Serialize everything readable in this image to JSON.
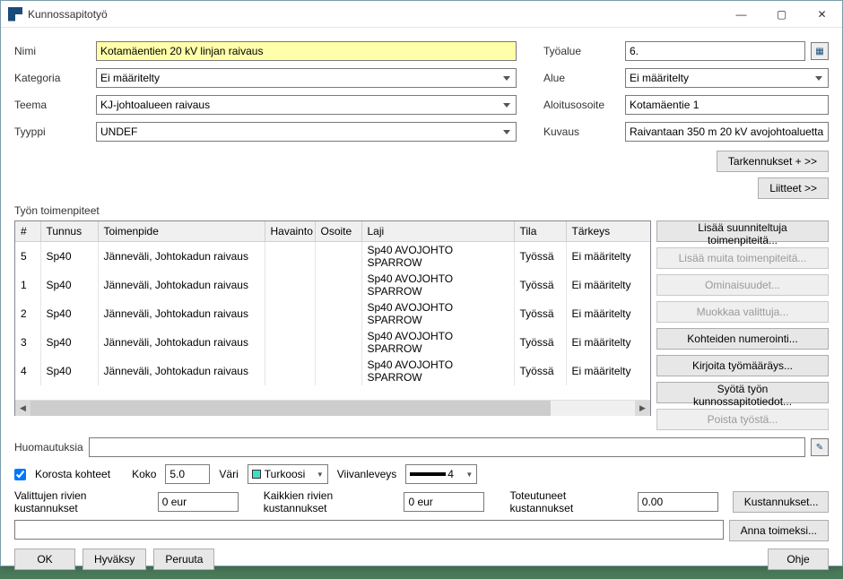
{
  "titlebar": {
    "title": "Kunnossapitotyö"
  },
  "form": {
    "nimi_label": "Nimi",
    "nimi": "Kotamäentien 20 kV linjan raivaus",
    "kategoria_label": "Kategoria",
    "kategoria": "Ei määritelty",
    "teema_label": "Teema",
    "teema": "KJ-johtoalueen raivaus",
    "tyyppi_label": "Tyyppi",
    "tyyppi": "UNDEF",
    "tyoalue_label": "Työalue",
    "tyoalue": "6.",
    "alue_label": "Alue",
    "alue": "Ei määritelty",
    "aloitusosoite_label": "Aloitusosoite",
    "aloitusosoite": "Kotamäentie 1",
    "kuvaus_label": "Kuvaus",
    "kuvaus": "Raivantaan 350 m 20 kV avojohtoaluetta"
  },
  "topbtns": {
    "tarkennukset": "Tarkennukset + >>",
    "liitteet": "Liitteet >>"
  },
  "table": {
    "caption": "Työn toimenpiteet",
    "cols": {
      "num": "#",
      "tunnus": "Tunnus",
      "toimenpide": "Toimenpide",
      "havainto": "Havainto",
      "osoite": "Osoite",
      "laji": "Laji",
      "tila": "Tila",
      "tarkeys": "Tärkeys"
    },
    "rows": [
      {
        "num": "5",
        "tunnus": "Sp40",
        "toimenpide": "Jänneväli, Johtokadun raivaus",
        "havainto": "",
        "osoite": "",
        "laji": "Sp40 AVOJOHTO SPARROW",
        "tila": "Työssä",
        "tarkeys": "Ei määritelty"
      },
      {
        "num": "1",
        "tunnus": "Sp40",
        "toimenpide": "Jänneväli, Johtokadun raivaus",
        "havainto": "",
        "osoite": "",
        "laji": "Sp40 AVOJOHTO SPARROW",
        "tila": "Työssä",
        "tarkeys": "Ei määritelty"
      },
      {
        "num": "2",
        "tunnus": "Sp40",
        "toimenpide": "Jänneväli, Johtokadun raivaus",
        "havainto": "",
        "osoite": "",
        "laji": "Sp40 AVOJOHTO SPARROW",
        "tila": "Työssä",
        "tarkeys": "Ei määritelty"
      },
      {
        "num": "3",
        "tunnus": "Sp40",
        "toimenpide": "Jänneväli, Johtokadun raivaus",
        "havainto": "",
        "osoite": "",
        "laji": "Sp40 AVOJOHTO SPARROW",
        "tila": "Työssä",
        "tarkeys": "Ei määritelty"
      },
      {
        "num": "4",
        "tunnus": "Sp40",
        "toimenpide": "Jänneväli, Johtokadun raivaus",
        "havainto": "",
        "osoite": "",
        "laji": "Sp40 AVOJOHTO SPARROW",
        "tila": "Työssä",
        "tarkeys": "Ei määritelty"
      }
    ]
  },
  "sidebtns": {
    "add_planned": "Lisää suunniteltuja toimenpiteitä...",
    "add_other": "Lisää muita toimenpiteitä...",
    "properties": "Ominaisuudet...",
    "edit_sel": "Muokkaa valittuja...",
    "numbering": "Kohteiden numerointi...",
    "write_order": "Kirjoita työmääräys...",
    "enter_maint": "Syötä työn kunnossapitotiedot...",
    "remove": "Poista työstä..."
  },
  "remarks": {
    "label": "Huomautuksia",
    "value": ""
  },
  "highlight": {
    "chk_label": "Korosta kohteet",
    "size_label": "Koko",
    "size": "5.0",
    "color_label": "Väri",
    "color_name": "Turkoosi",
    "lineweight_label": "Viivanleveys",
    "lineweight": "4"
  },
  "costs": {
    "sel_label": "Valittujen rivien kustannukset",
    "sel": "0 eur",
    "all_label": "Kaikkien rivien kustannukset",
    "all": "0 eur",
    "actual_label": "Toteutuneet kustannukset",
    "actual": "0.00",
    "btn": "Kustannukset..."
  },
  "action": {
    "btn": "Anna toimeksi..."
  },
  "footer": {
    "ok": "OK",
    "apply": "Hyväksy",
    "cancel": "Peruuta",
    "help": "Ohje"
  }
}
